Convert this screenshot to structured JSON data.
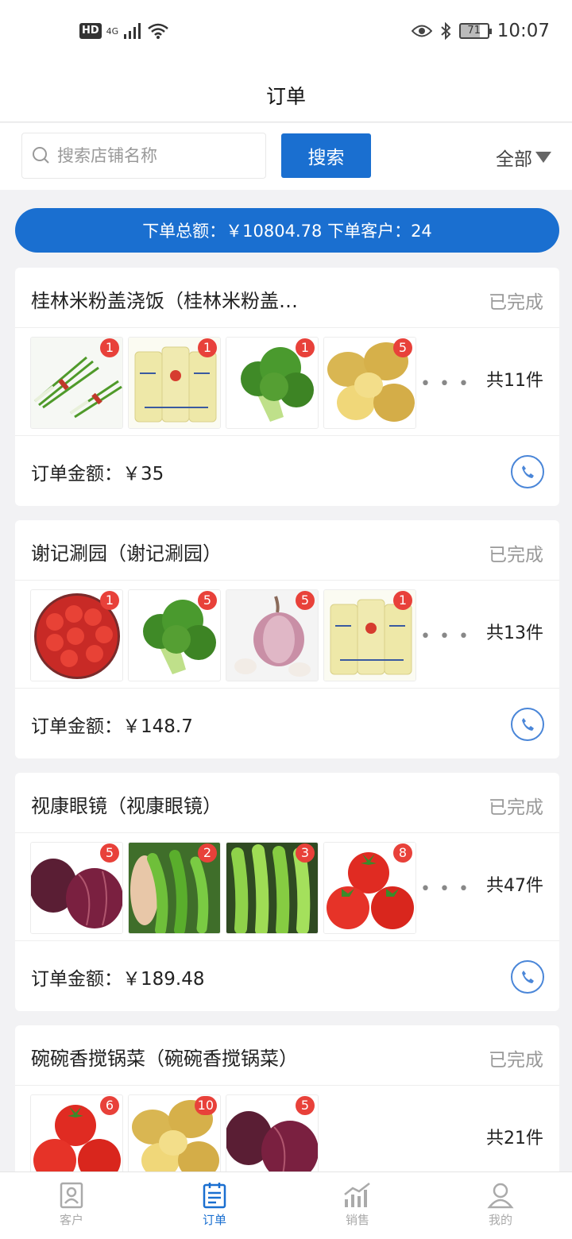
{
  "status_bar": {
    "hd": "HD",
    "signal": "4G",
    "battery": "71",
    "time": "10:07"
  },
  "header": {
    "title": "订单"
  },
  "search": {
    "placeholder": "搜索店铺名称",
    "button": "搜索",
    "filter": "全部"
  },
  "summary": {
    "text": "下单总额：￥10804.78  下单客户：24"
  },
  "orders": [
    {
      "shop": "桂林米粉盖浇饭（桂林米粉盖…",
      "status": "已完成",
      "items": [
        {
          "product": "chives",
          "qty": "1"
        },
        {
          "product": "noodles",
          "qty": "1"
        },
        {
          "product": "broccoli",
          "qty": "1"
        },
        {
          "product": "potato",
          "qty": "5"
        }
      ],
      "more": "• • •",
      "count": "共11件",
      "amount": "订单金额：￥35"
    },
    {
      "shop": "谢记涮园（谢记涮园）",
      "status": "已完成",
      "items": [
        {
          "product": "cherry-tomato",
          "qty": "1"
        },
        {
          "product": "broccoli",
          "qty": "5"
        },
        {
          "product": "garlic",
          "qty": "5"
        },
        {
          "product": "noodles",
          "qty": "1"
        }
      ],
      "more": "• • •",
      "count": "共13件",
      "amount": "订单金额：￥148.7"
    },
    {
      "shop": "视康眼镜（视康眼镜）",
      "status": "已完成",
      "items": [
        {
          "product": "red-onion",
          "qty": "5"
        },
        {
          "product": "green-pepper",
          "qty": "2"
        },
        {
          "product": "long-pepper",
          "qty": "3"
        },
        {
          "product": "tomato",
          "qty": "8"
        }
      ],
      "more": "• • •",
      "count": "共47件",
      "amount": "订单金额：￥189.48"
    },
    {
      "shop": "碗碗香搅锅菜（碗碗香搅锅菜）",
      "status": "已完成",
      "items": [
        {
          "product": "tomato",
          "qty": "6"
        },
        {
          "product": "potato",
          "qty": "10"
        },
        {
          "product": "red-onion",
          "qty": "5"
        }
      ],
      "count": "共21件"
    }
  ],
  "nav": [
    {
      "label": "客户",
      "icon": "customer-icon",
      "active": false
    },
    {
      "label": "订单",
      "icon": "order-icon",
      "active": true
    },
    {
      "label": "销售",
      "icon": "sales-chart-icon",
      "active": false
    },
    {
      "label": "我的",
      "icon": "profile-icon",
      "active": false
    }
  ],
  "colors": {
    "primary": "#1a6fd0",
    "badge": "#e8413a",
    "status_text": "#999999"
  }
}
